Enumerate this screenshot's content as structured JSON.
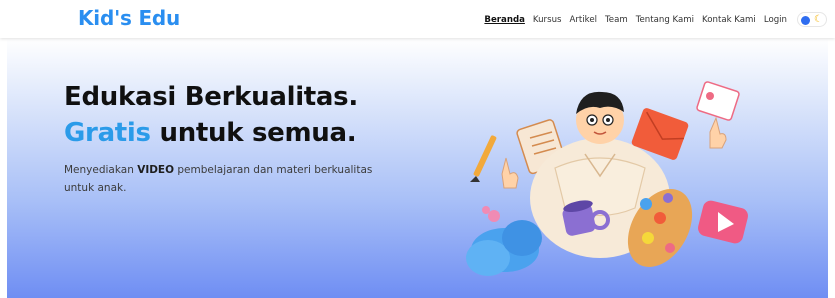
{
  "header": {
    "brand": "Kid's Edu",
    "nav": [
      "Beranda",
      "Kursus",
      "Artikel",
      "Team",
      "Tentang Kami",
      "Kontak Kami",
      "Login"
    ],
    "active_index": 0,
    "theme_toggle_icon": "moon-icon"
  },
  "hero": {
    "headline_line1": "Edukasi Berkualitas.",
    "headline_accent": "Gratis",
    "headline_rest": " untuk semua.",
    "sub_prefix": "Menyediakan ",
    "sub_bold": "VIDEO",
    "sub_suffix": " pembelajaran dan materi berkualitas untuk anak.",
    "illustration_icon": "child-with-school-supplies-illustration"
  },
  "colors": {
    "brand": "#2a8ef0",
    "accent": "#2b9be9",
    "gradient_bottom": "#6f8ef3"
  }
}
